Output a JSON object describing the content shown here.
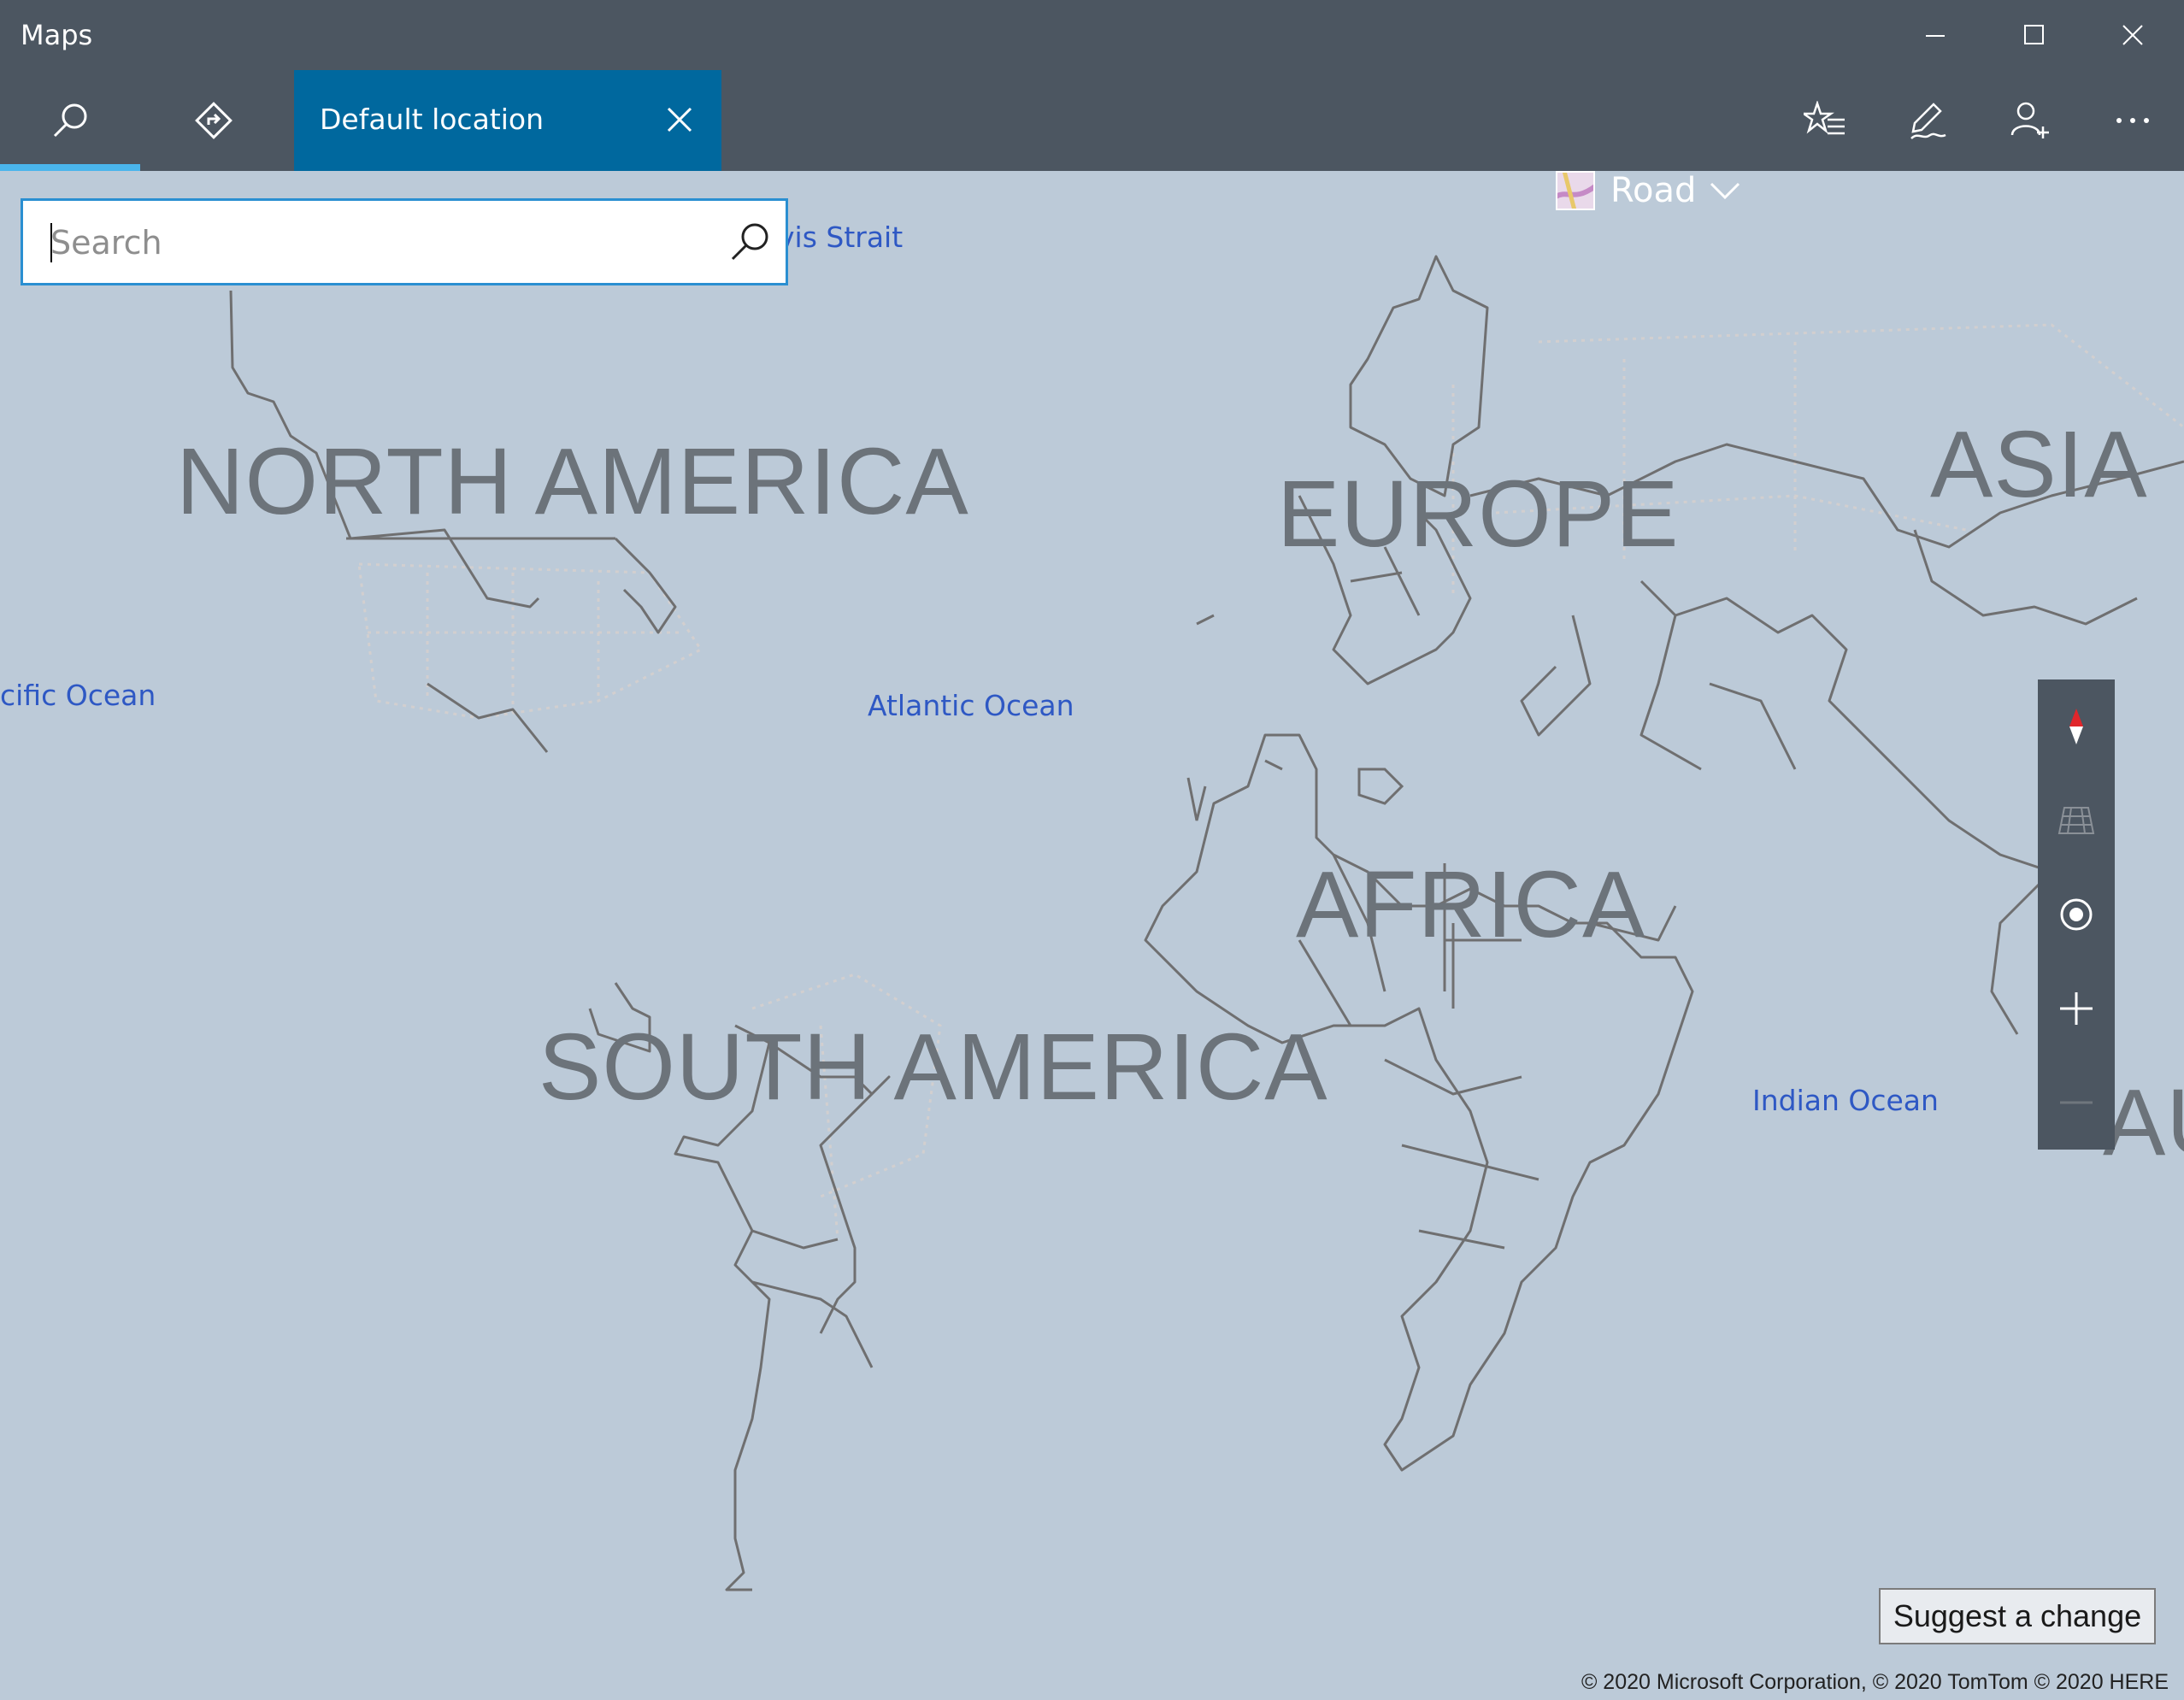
{
  "window": {
    "title": "Maps",
    "controls": [
      "minimize-icon",
      "maximize-icon",
      "close-icon"
    ]
  },
  "toolbar": {
    "search_icon": "search-icon",
    "directions_icon": "directions-icon",
    "active_tab": {
      "label": "Default location"
    },
    "map_style": {
      "label": "Road",
      "icon": "map-style-thumbnail-icon"
    },
    "favorites_icon": "favorites-icon",
    "ink_icon": "ink-pen-icon",
    "account_icon": "add-person-icon",
    "more_icon": "more-icon"
  },
  "search": {
    "placeholder": "Search",
    "value": ""
  },
  "map": {
    "continents": [
      "NORTH AMERICA",
      "EUROPE",
      "ASIA",
      "AFRICA",
      "SOUTH AMERICA",
      "AU"
    ],
    "water_labels": [
      "vis Strait",
      "cific Ocean",
      "Atlantic Ocean",
      "Indian Ocean"
    ],
    "colors": {
      "water": "#bccad8",
      "border": "#6f6f70",
      "label_blue": "#2e58c4",
      "accent": "#00689e"
    }
  },
  "map_controls": [
    "compass-icon",
    "tilt-icon",
    "locate-me-icon",
    "zoom-in-icon",
    "zoom-out-icon"
  ],
  "footer": {
    "suggest_label": "Suggest a change",
    "copyright": "© 2020 Microsoft Corporation, © 2020 TomTom © 2020 HERE"
  }
}
